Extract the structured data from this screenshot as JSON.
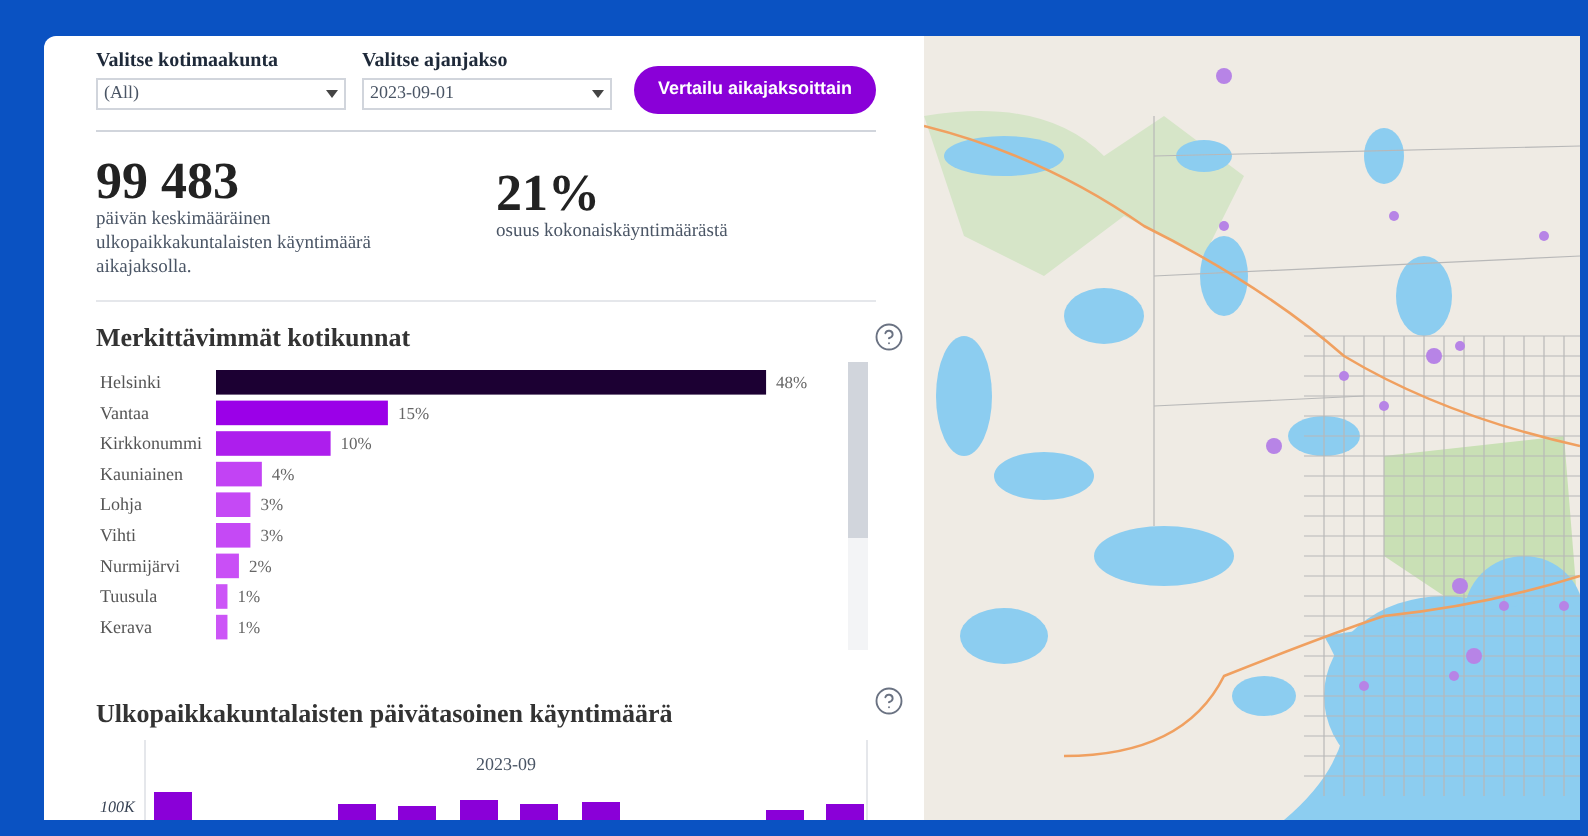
{
  "filters": [
    {
      "label": "Valitse kotimaakunta",
      "value": "(All)"
    },
    {
      "label": "Valitse ajanjakso",
      "value": "2023-09-01"
    }
  ],
  "compare_button": "Vertailu aikajaksoittain",
  "stats": [
    {
      "value": "99 483",
      "caption": "päivän keskimääräinen ulkopaikkakuntalaisten käyntimäärä aikajaksolla."
    },
    {
      "value": "21%",
      "caption": "osuus kokonaiskäyntimäärästä"
    }
  ],
  "top_municipalities": {
    "title": "Merkittävimmät kotikunnat",
    "chart_data": {
      "type": "bar",
      "orientation": "horizontal",
      "categories": [
        "Helsinki",
        "Vantaa",
        "Kirkkonummi",
        "Kauniainen",
        "Lohja",
        "Vihti",
        "Nurmijärvi",
        "Tuusula",
        "Kerava"
      ],
      "values": [
        48,
        15,
        10,
        4,
        3,
        3,
        2,
        1,
        1
      ],
      "value_labels": [
        "48%",
        "15%",
        "10%",
        "4%",
        "3%",
        "3%",
        "2%",
        "1%",
        "1%"
      ]
    }
  },
  "daily_visits": {
    "title": "Ulkopaikkakuntalaisten päivätasoinen käyntimäärä",
    "period_label": "2023-09",
    "tick_label": "100K"
  }
}
